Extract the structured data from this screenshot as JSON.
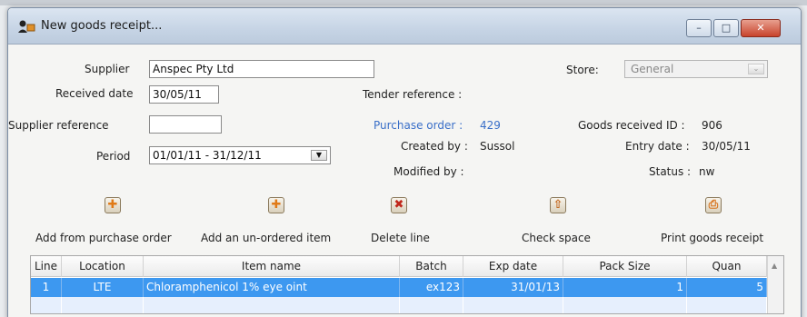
{
  "window": {
    "title": "New goods receipt...",
    "controls": {
      "minimize": "–",
      "maximize": "□",
      "close": "✕"
    }
  },
  "form": {
    "supplier_label": "Supplier",
    "supplier_value": "Anspec Pty Ltd",
    "received_date_label": "Received date",
    "received_date_value": "30/05/11",
    "supplier_reference_label": "Supplier reference",
    "supplier_reference_value": "",
    "period_label": "Period",
    "period_value": "01/01/11 - 31/12/11",
    "tender_reference_label": "Tender reference :",
    "purchase_order_label": "Purchase order :",
    "purchase_order_value": "429",
    "created_by_label": "Created by :",
    "created_by_value": "Sussol",
    "modified_by_label": "Modified by :",
    "modified_by_value": "",
    "store_label": "Store:",
    "store_value": "General",
    "goods_received_id_label": "Goods received ID :",
    "goods_received_id_value": "906",
    "entry_date_label": "Entry date :",
    "entry_date_value": "30/05/11",
    "status_label": "Status :",
    "status_value": "nw"
  },
  "toolbar": {
    "add_from_po": "Add from purchase order",
    "add_unordered": "Add an un-ordered item",
    "delete_line": "Delete line",
    "check_space": "Check space",
    "print_receipt": "Print goods receipt"
  },
  "table": {
    "headers": [
      "Line",
      "Location",
      "Item name",
      "Batch",
      "Exp date",
      "Pack Size",
      "Quan"
    ],
    "rows": [
      {
        "line": "1",
        "location": "LTE",
        "item_name": "Chloramphenicol 1% eye oint",
        "batch": "ex123",
        "exp_date": "31/01/13",
        "pack_size": "1",
        "quantity": "5"
      }
    ]
  },
  "colors": {
    "selection": "#3d98f0",
    "link_blue": "#3a6fc8",
    "titlebar": "#c6d4e5"
  },
  "icons": [
    "goods-receipt-app-icon",
    "add-orange-icon",
    "add-orange-icon",
    "delete-red-x-icon",
    "check-space-icon",
    "print-icon"
  ]
}
